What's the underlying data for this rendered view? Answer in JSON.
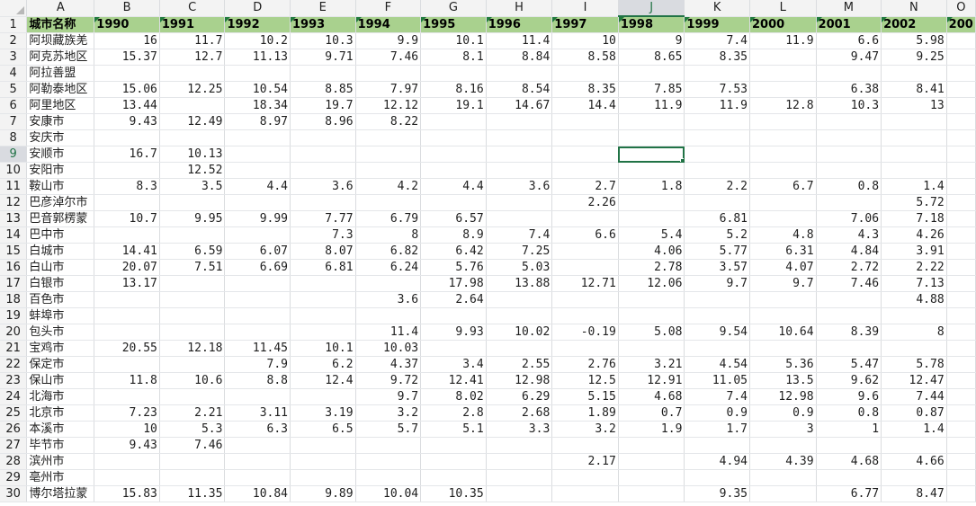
{
  "sheet": {
    "selected_cell": "J9",
    "columns": [
      "A",
      "B",
      "C",
      "D",
      "E",
      "F",
      "G",
      "H",
      "I",
      "J",
      "K",
      "L",
      "M",
      "N",
      "O"
    ],
    "header": [
      "城市名称",
      "1990",
      "1991",
      "1992",
      "1993",
      "1994",
      "1995",
      "1996",
      "1997",
      "1998",
      "1999",
      "2000",
      "2001",
      "2002",
      "200"
    ],
    "rows": [
      {
        "n": "2",
        "cells": [
          "阿坝藏族羌",
          "16",
          "11.7",
          "10.2",
          "10.3",
          "9.9",
          "10.1",
          "11.4",
          "10",
          "9",
          "7.4",
          "11.9",
          "6.6",
          "5.98",
          ""
        ]
      },
      {
        "n": "3",
        "cells": [
          "阿克苏地区",
          "15.37",
          "12.7",
          "11.13",
          "9.71",
          "7.46",
          "8.1",
          "8.84",
          "8.58",
          "8.65",
          "8.35",
          "",
          "9.47",
          "9.25",
          ""
        ]
      },
      {
        "n": "4",
        "cells": [
          "阿拉善盟",
          "",
          "",
          "",
          "",
          "",
          "",
          "",
          "",
          "",
          "",
          "",
          "",
          "",
          ""
        ]
      },
      {
        "n": "5",
        "cells": [
          "阿勒泰地区",
          "15.06",
          "12.25",
          "10.54",
          "8.85",
          "7.97",
          "8.16",
          "8.54",
          "8.35",
          "7.85",
          "7.53",
          "",
          "6.38",
          "8.41",
          ""
        ]
      },
      {
        "n": "6",
        "cells": [
          "阿里地区",
          "13.44",
          "",
          "18.34",
          "19.7",
          "12.12",
          "19.1",
          "14.67",
          "14.4",
          "11.9",
          "11.9",
          "12.8",
          "10.3",
          "13",
          ""
        ]
      },
      {
        "n": "7",
        "cells": [
          "安康市",
          "9.43",
          "12.49",
          "8.97",
          "8.96",
          "8.22",
          "",
          "",
          "",
          "",
          "",
          "",
          "",
          "",
          ""
        ]
      },
      {
        "n": "8",
        "cells": [
          "安庆市",
          "",
          "",
          "",
          "",
          "",
          "",
          "",
          "",
          "",
          "",
          "",
          "",
          "",
          ""
        ]
      },
      {
        "n": "9",
        "cells": [
          "安顺市",
          "16.7",
          "10.13",
          "",
          "",
          "",
          "",
          "",
          "",
          "",
          "",
          "",
          "",
          "",
          ""
        ]
      },
      {
        "n": "10",
        "cells": [
          "安阳市",
          "",
          "12.52",
          "",
          "",
          "",
          "",
          "",
          "",
          "",
          "",
          "",
          "",
          "",
          ""
        ]
      },
      {
        "n": "11",
        "cells": [
          "鞍山市",
          "8.3",
          "3.5",
          "4.4",
          "3.6",
          "4.2",
          "4.4",
          "3.6",
          "2.7",
          "1.8",
          "2.2",
          "6.7",
          "0.8",
          "1.4",
          ""
        ]
      },
      {
        "n": "12",
        "cells": [
          "巴彦淖尔市",
          "",
          "",
          "",
          "",
          "",
          "",
          "",
          "2.26",
          "",
          "",
          "",
          "",
          "5.72",
          ""
        ]
      },
      {
        "n": "13",
        "cells": [
          "巴音郭楞蒙",
          "10.7",
          "9.95",
          "9.99",
          "7.77",
          "6.79",
          "6.57",
          "",
          "",
          "",
          "6.81",
          "",
          "7.06",
          "7.18",
          ""
        ]
      },
      {
        "n": "14",
        "cells": [
          "巴中市",
          "",
          "",
          "",
          "7.3",
          "8",
          "8.9",
          "7.4",
          "6.6",
          "5.4",
          "5.2",
          "4.8",
          "4.3",
          "4.26",
          ""
        ]
      },
      {
        "n": "15",
        "cells": [
          "白城市",
          "14.41",
          "6.59",
          "6.07",
          "8.07",
          "6.82",
          "6.42",
          "7.25",
          "",
          "4.06",
          "5.77",
          "6.31",
          "4.84",
          "3.91",
          ""
        ]
      },
      {
        "n": "16",
        "cells": [
          "白山市",
          "20.07",
          "7.51",
          "6.69",
          "6.81",
          "6.24",
          "5.76",
          "5.03",
          "",
          "2.78",
          "3.57",
          "4.07",
          "2.72",
          "2.22",
          ""
        ]
      },
      {
        "n": "17",
        "cells": [
          "白银市",
          "13.17",
          "",
          "",
          "",
          "",
          "17.98",
          "13.88",
          "12.71",
          "12.06",
          "9.7",
          "9.7",
          "7.46",
          "7.13",
          ""
        ]
      },
      {
        "n": "18",
        "cells": [
          "百色市",
          "",
          "",
          "",
          "",
          "3.6",
          "2.64",
          "",
          "",
          "",
          "",
          "",
          "",
          "4.88",
          ""
        ]
      },
      {
        "n": "19",
        "cells": [
          "蚌埠市",
          "",
          "",
          "",
          "",
          "",
          "",
          "",
          "",
          "",
          "",
          "",
          "",
          "",
          ""
        ]
      },
      {
        "n": "20",
        "cells": [
          "包头市",
          "",
          "",
          "",
          "",
          "11.4",
          "9.93",
          "10.02",
          "-0.19",
          "5.08",
          "9.54",
          "10.64",
          "8.39",
          "8",
          ""
        ]
      },
      {
        "n": "21",
        "cells": [
          "宝鸡市",
          "20.55",
          "12.18",
          "11.45",
          "10.1",
          "10.03",
          "",
          "",
          "",
          "",
          "",
          "",
          "",
          "",
          ""
        ]
      },
      {
        "n": "22",
        "cells": [
          "保定市",
          "",
          "",
          "7.9",
          "6.2",
          "4.37",
          "3.4",
          "2.55",
          "2.76",
          "3.21",
          "4.54",
          "5.36",
          "5.47",
          "5.78",
          ""
        ]
      },
      {
        "n": "23",
        "cells": [
          "保山市",
          "11.8",
          "10.6",
          "8.8",
          "12.4",
          "9.72",
          "12.41",
          "12.98",
          "12.5",
          "12.91",
          "11.05",
          "13.5",
          "9.62",
          "12.47",
          ""
        ]
      },
      {
        "n": "24",
        "cells": [
          "北海市",
          "",
          "",
          "",
          "",
          "9.7",
          "8.02",
          "6.29",
          "5.15",
          "4.68",
          "7.4",
          "12.98",
          "9.6",
          "7.44",
          ""
        ]
      },
      {
        "n": "25",
        "cells": [
          "北京市",
          "7.23",
          "2.21",
          "3.11",
          "3.19",
          "3.2",
          "2.8",
          "2.68",
          "1.89",
          "0.7",
          "0.9",
          "0.9",
          "0.8",
          "0.87",
          ""
        ]
      },
      {
        "n": "26",
        "cells": [
          "本溪市",
          "10",
          "5.3",
          "6.3",
          "6.5",
          "5.7",
          "5.1",
          "3.3",
          "3.2",
          "1.9",
          "1.7",
          "3",
          "1",
          "1.4",
          ""
        ]
      },
      {
        "n": "27",
        "cells": [
          "毕节市",
          "9.43",
          "7.46",
          "",
          "",
          "",
          "",
          "",
          "",
          "",
          "",
          "",
          "",
          "",
          ""
        ]
      },
      {
        "n": "28",
        "cells": [
          "滨州市",
          "",
          "",
          "",
          "",
          "",
          "",
          "",
          "2.17",
          "",
          "4.94",
          "4.39",
          "4.68",
          "4.66",
          ""
        ]
      },
      {
        "n": "29",
        "cells": [
          "亳州市",
          "",
          "",
          "",
          "",
          "",
          "",
          "",
          "",
          "",
          "",
          "",
          "",
          "",
          ""
        ]
      },
      {
        "n": "30",
        "cells": [
          "博尔塔拉蒙",
          "15.83",
          "11.35",
          "10.84",
          "9.89",
          "10.04",
          "10.35",
          "",
          "",
          "",
          "9.35",
          "",
          "6.77",
          "8.47",
          ""
        ]
      }
    ]
  }
}
